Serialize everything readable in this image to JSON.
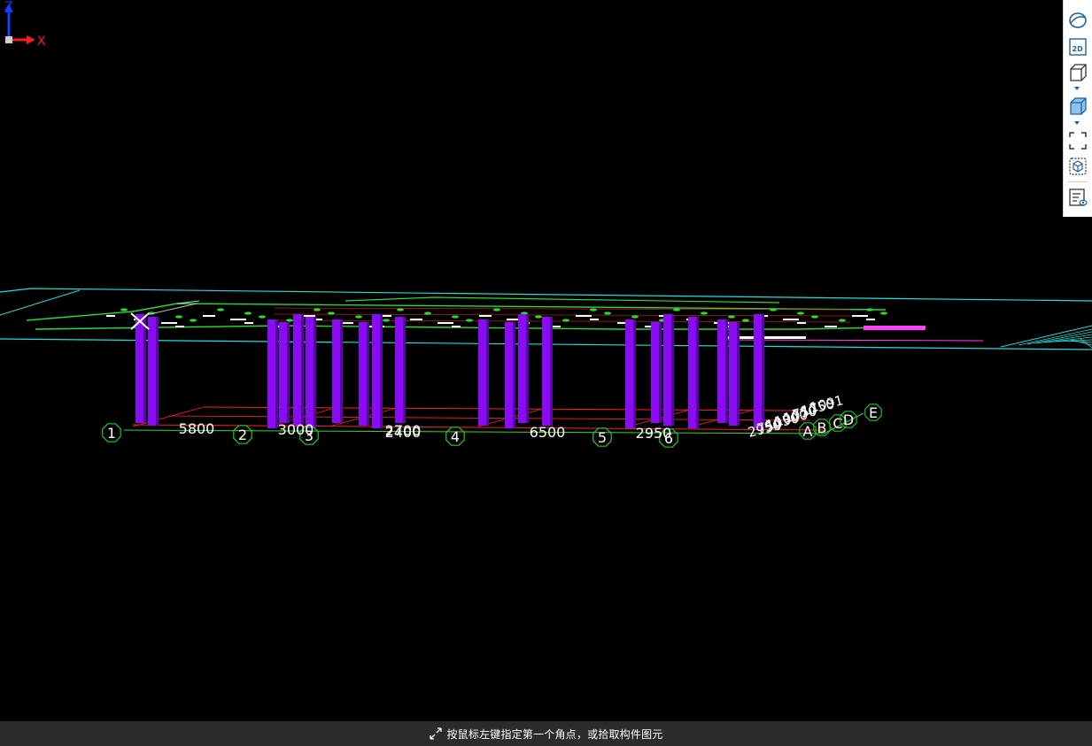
{
  "colors": {
    "background": "#000000",
    "grid_line": "#ff2020",
    "axis_bubble": "#22c922",
    "column": "#8a0cf5",
    "column_dark": "#5a07a8",
    "floor_outline": "#19e0e0",
    "beam_green": "#2bdc2b",
    "magenta": "#ff40ff",
    "label": "#ffffff",
    "toolbar_icon": "#1f5fa8"
  },
  "grid": {
    "axes_x": [
      "1",
      "2",
      "3",
      "4",
      "5",
      "6"
    ],
    "axes_y": [
      "A",
      "B",
      "C",
      "D",
      "E"
    ],
    "spans": [
      "5800",
      "3000",
      "2700",
      "2400",
      "6500",
      "2950"
    ],
    "side_dims": [
      "2950",
      "750",
      "1050",
      "1000",
      "1070",
      "750",
      "1750",
      "1091"
    ]
  },
  "toolbar": {
    "items": [
      {
        "name": "perspective-view-icon"
      },
      {
        "name": "2d-view-icon",
        "label": "2D"
      },
      {
        "name": "3d-view-icon"
      },
      {
        "name": "shaded-box-icon"
      },
      {
        "name": "zoom-extents-icon"
      },
      {
        "name": "component-box-icon"
      },
      {
        "name": "display-settings-icon"
      }
    ]
  },
  "triad": {
    "z_label": "Z",
    "x_label": "X"
  },
  "status": {
    "icon": "corner-arrows-icon",
    "text": "按鼠标左键指定第一个角点，或拾取构件图元"
  }
}
